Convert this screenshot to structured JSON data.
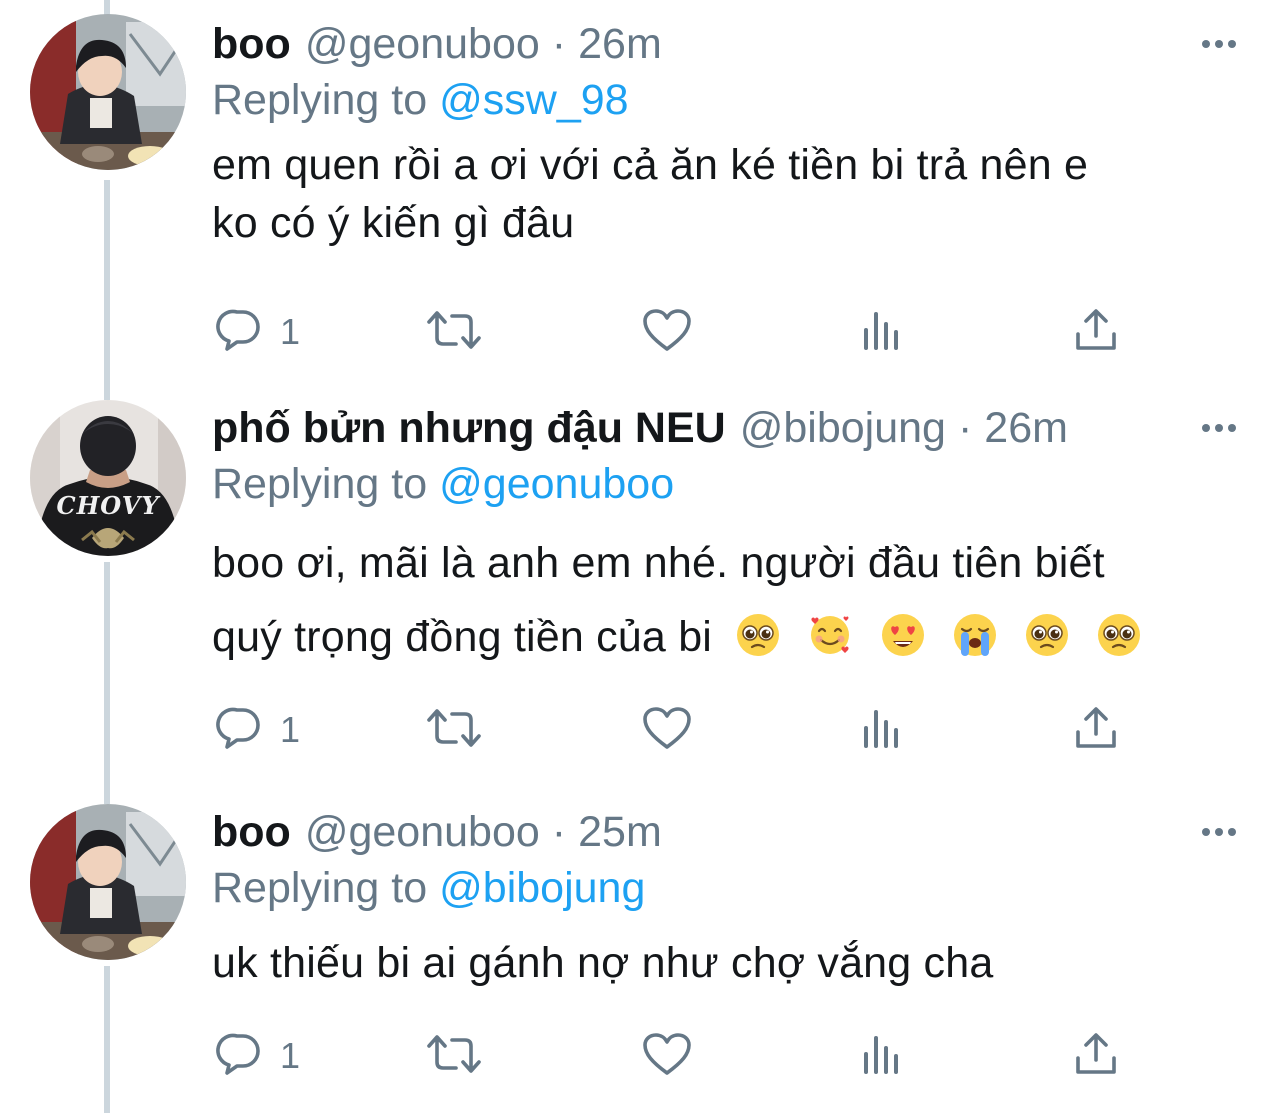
{
  "thread": {
    "tweets": [
      {
        "name": "boo",
        "handle": "@geonuboo",
        "separator": "·",
        "time": "26m",
        "replying_prefix": "Replying to",
        "replying_to": "@ssw_98",
        "text_lines": [
          "em quen rồi a ơi với cả ăn ké tiền bi trả nên e",
          "ko có ý kiến gì đâu"
        ],
        "emojis": [],
        "reply_count": "1",
        "avatar": "person-eating-photo"
      },
      {
        "name": "phố bửn nhưng đậu NEU",
        "handle": "@bibojung",
        "separator": "·",
        "time": "26m",
        "replying_prefix": "Replying to",
        "replying_to": "@geonuboo",
        "text_lines": [
          "boo ơi, mãi là anh em nhé. người đầu tiên biết",
          "quý trọng đồng tiền của bi"
        ],
        "emojis": [
          "pleading-face-emoji",
          "smiling-face-with-hearts-emoji",
          "heart-eyes-emoji",
          "loudly-crying-face-emoji",
          "pleading-face-emoji",
          "pleading-face-emoji"
        ],
        "reply_count": "1",
        "avatar": "chovy-shirt-photo",
        "avatar_text": "CHOVY"
      },
      {
        "name": "boo",
        "handle": "@geonuboo",
        "separator": "·",
        "time": "25m",
        "replying_prefix": "Replying to",
        "replying_to": "@bibojung",
        "text_lines": [
          "uk thiếu bi ai gánh nợ như chợ vắng cha"
        ],
        "emojis": [],
        "reply_count": "1",
        "avatar": "person-eating-photo"
      }
    ]
  },
  "icons": {
    "reply": "reply-icon",
    "retweet": "retweet-icon",
    "like": "like-icon",
    "analytics": "analytics-icon",
    "share": "share-icon",
    "more": "more-icon"
  },
  "colors": {
    "text": "#14171a",
    "secondary": "#657786",
    "link": "#1da1f2",
    "thread_line": "#ccd6dd",
    "background": "#ffffff"
  }
}
